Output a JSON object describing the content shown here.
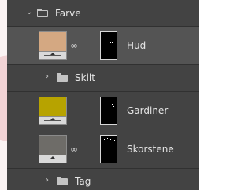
{
  "layers": {
    "farve": {
      "name": "Farve"
    },
    "hud": {
      "name": "Hud",
      "color": "#d4a882"
    },
    "skilt": {
      "name": "Skilt"
    },
    "gardiner": {
      "name": "Gardiner",
      "color": "#b7a300"
    },
    "skorstene": {
      "name": "Skorstene",
      "color": "#6e6c68"
    },
    "tag": {
      "name": "Tag"
    }
  },
  "icons": {
    "expanded": "chevron-down-icon",
    "collapsed": "chevron-right-icon",
    "link": "link-icon",
    "folder": "folder-icon"
  }
}
